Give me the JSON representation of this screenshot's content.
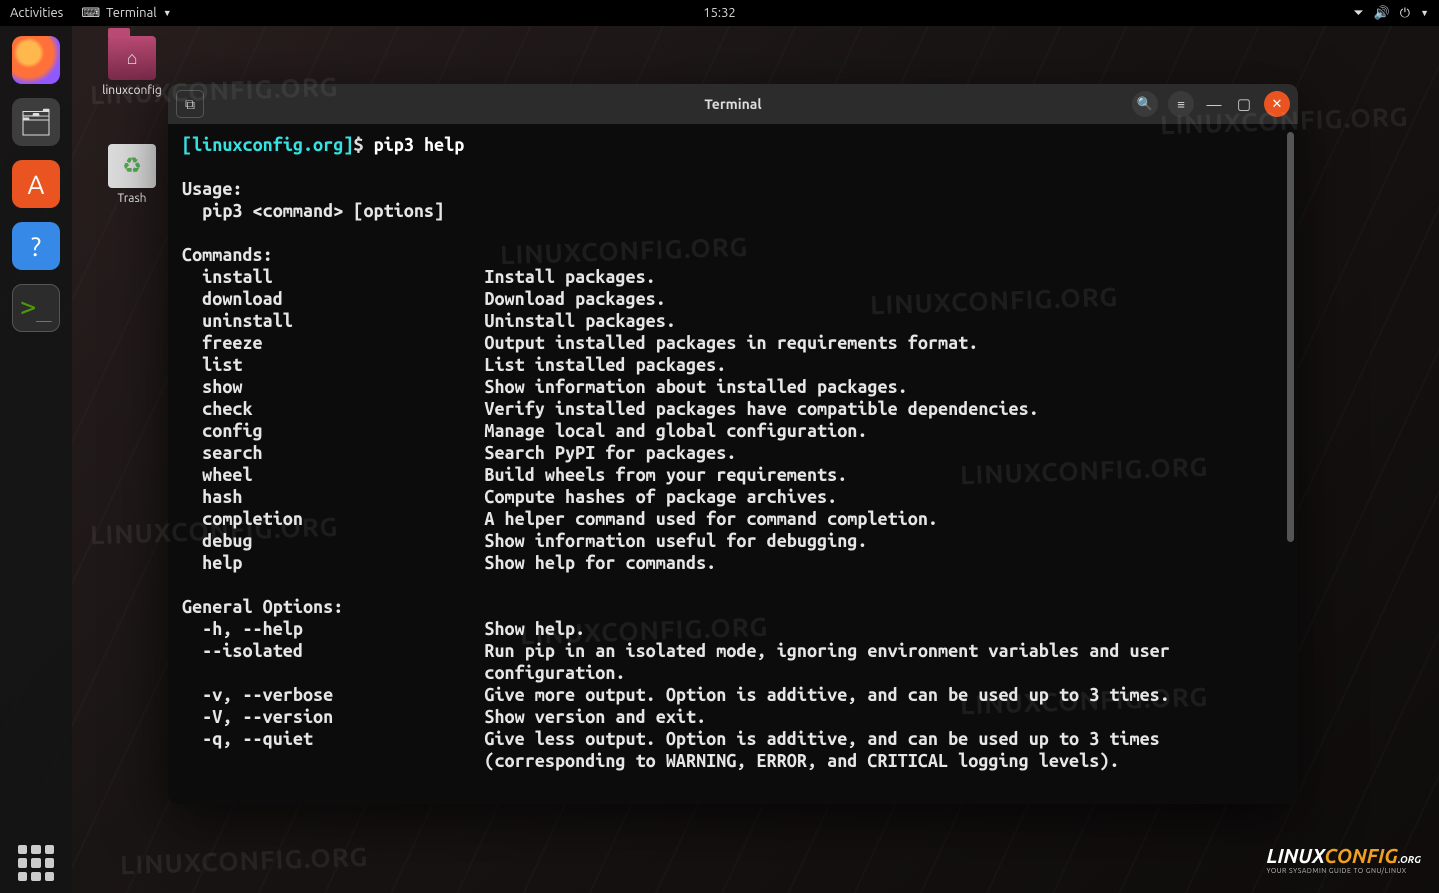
{
  "topbar": {
    "activities": "Activities",
    "app_label": "Terminal",
    "clock": "15:32"
  },
  "desktop_icons": {
    "folder_label": "linuxconfig",
    "trash_label": "Trash"
  },
  "terminal": {
    "title": "Terminal",
    "prompt_host": "linuxconfig.org",
    "prompt_symbol": "$",
    "command": "pip3 help",
    "usage_heading": "Usage:",
    "usage_line": "  pip3 <command> [options]",
    "commands_heading": "Commands:",
    "commands": [
      {
        "name": "install",
        "desc": "Install packages."
      },
      {
        "name": "download",
        "desc": "Download packages."
      },
      {
        "name": "uninstall",
        "desc": "Uninstall packages."
      },
      {
        "name": "freeze",
        "desc": "Output installed packages in requirements format."
      },
      {
        "name": "list",
        "desc": "List installed packages."
      },
      {
        "name": "show",
        "desc": "Show information about installed packages."
      },
      {
        "name": "check",
        "desc": "Verify installed packages have compatible dependencies."
      },
      {
        "name": "config",
        "desc": "Manage local and global configuration."
      },
      {
        "name": "search",
        "desc": "Search PyPI for packages."
      },
      {
        "name": "wheel",
        "desc": "Build wheels from your requirements."
      },
      {
        "name": "hash",
        "desc": "Compute hashes of package archives."
      },
      {
        "name": "completion",
        "desc": "A helper command used for command completion."
      },
      {
        "name": "debug",
        "desc": "Show information useful for debugging."
      },
      {
        "name": "help",
        "desc": "Show help for commands."
      }
    ],
    "general_heading": "General Options:",
    "options": [
      {
        "flag": "-h, --help",
        "desc": "Show help."
      },
      {
        "flag": "--isolated",
        "desc": "Run pip in an isolated mode, ignoring environment variables and user\n                              configuration."
      },
      {
        "flag": "-v, --verbose",
        "desc": "Give more output. Option is additive, and can be used up to 3 times."
      },
      {
        "flag": "-V, --version",
        "desc": "Show version and exit."
      },
      {
        "flag": "-q, --quiet",
        "desc": "Give less output. Option is additive, and can be used up to 3 times\n                              (corresponding to WARNING, ERROR, and CRITICAL logging levels)."
      }
    ]
  },
  "watermark_text": "LINUXCONFIG.ORG",
  "logo": {
    "brand": "LINUX",
    "suffix": "CONFIG",
    "tag": "YOUR SYSADMIN GUIDE TO GNU/LINUX"
  }
}
